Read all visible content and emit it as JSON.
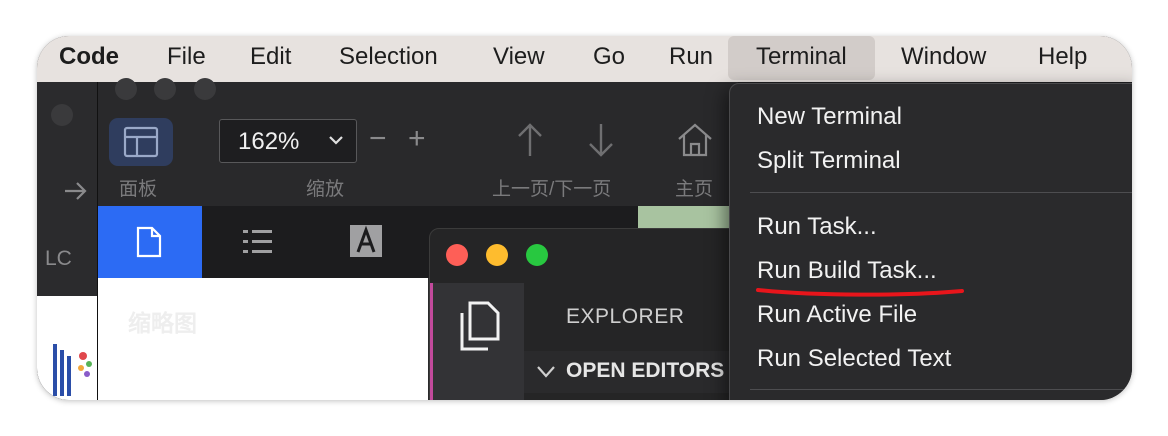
{
  "menubar": {
    "app_name": "Code",
    "items": [
      "File",
      "Edit",
      "Selection",
      "View",
      "Go",
      "Run",
      "Terminal",
      "Window",
      "Help"
    ],
    "active": "Terminal"
  },
  "left_window": {
    "partial_text": "LC"
  },
  "pdf_viewer": {
    "panel_label": "面板",
    "zoom_value": "162%",
    "zoom_label": "缩放",
    "zoom_out": "−",
    "zoom_in": "+",
    "nav_label": "上一页/下一页",
    "home_label": "主页",
    "pane_title": "缩略图"
  },
  "vscode": {
    "explorer_title": "EXPLORER",
    "section_open_editors": "OPEN EDITORS"
  },
  "terminal_menu": {
    "items": [
      {
        "label": "New Terminal"
      },
      {
        "label": "Split Terminal"
      },
      {
        "label": "Run Task..."
      },
      {
        "label": "Run Build Task..."
      },
      {
        "label": "Run Active File"
      },
      {
        "label": "Run Selected Text"
      }
    ],
    "highlight_item": "Run Build Task...",
    "highlight_color": "#e8151b"
  }
}
